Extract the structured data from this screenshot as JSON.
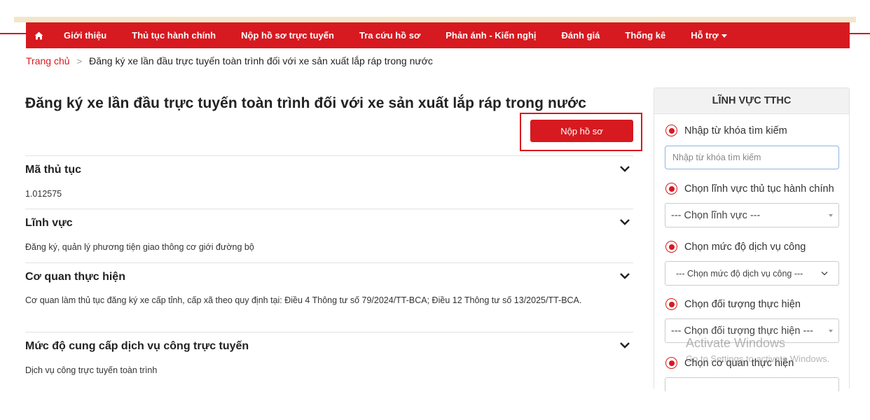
{
  "nav": {
    "home_icon": "home-icon",
    "items": [
      {
        "label": "Giới thiệu"
      },
      {
        "label": "Thủ tục hành chính"
      },
      {
        "label": "Nộp hồ sơ trực tuyến"
      },
      {
        "label": "Tra cứu hồ sơ"
      },
      {
        "label": "Phản ánh - Kiến nghị"
      },
      {
        "label": "Đánh giá"
      },
      {
        "label": "Thống kê"
      },
      {
        "label": "Hỗ trợ"
      }
    ]
  },
  "breadcrumb": {
    "home": "Trang chủ",
    "separator": ">",
    "current": "Đăng ký xe lần đầu trực tuyến toàn trình đối với xe sản xuất lắp ráp trong nước"
  },
  "main": {
    "title": "Đăng ký xe lần đầu trực tuyến toàn trình đối với xe sản xuất lắp ráp trong nước",
    "submit_label": "Nộp hồ sơ",
    "sections": [
      {
        "title": "Mã thủ tục",
        "value": "1.012575"
      },
      {
        "title": "Lĩnh vực",
        "value": "Đăng ký, quản lý phương tiện giao thông cơ giới đường bộ"
      },
      {
        "title": "Cơ quan thực hiện",
        "value": "Cơ quan làm thủ tục đăng ký xe cấp tỉnh, cấp xã theo quy định tại: Điều 4 Thông tư số 79/2024/TT-BCA; Điều 12 Thông tư số 13/2025/TT-BCA."
      },
      {
        "title": "Mức độ cung cấp dịch vụ công trực tuyến",
        "value": "Dịch vụ công trực tuyến toàn trình"
      }
    ]
  },
  "sidebar": {
    "header": "LĨNH VỰC TTHC",
    "keyword_label": "Nhập từ khóa tìm kiếm",
    "keyword_placeholder": "Nhập từ khóa tìm kiếm",
    "field_label": "Chọn lĩnh vực thủ tục hành chính",
    "field_select": "--- Chọn lĩnh vực ---",
    "level_label": "Chọn mức độ dịch vụ công",
    "level_select": "--- Chọn mức độ dịch vụ công ---",
    "target_label": "Chọn đối tượng thực hiện",
    "target_select": "--- Chọn đối tượng thực hiện ---",
    "agency_label": "Chọn cơ quan thực hiện"
  },
  "watermark": {
    "title": "Activate Windows",
    "subtitle": "Go to Settings to activate Windows."
  },
  "colors": {
    "brand_red": "#d71920",
    "input_focus": "#8fb4e0"
  }
}
